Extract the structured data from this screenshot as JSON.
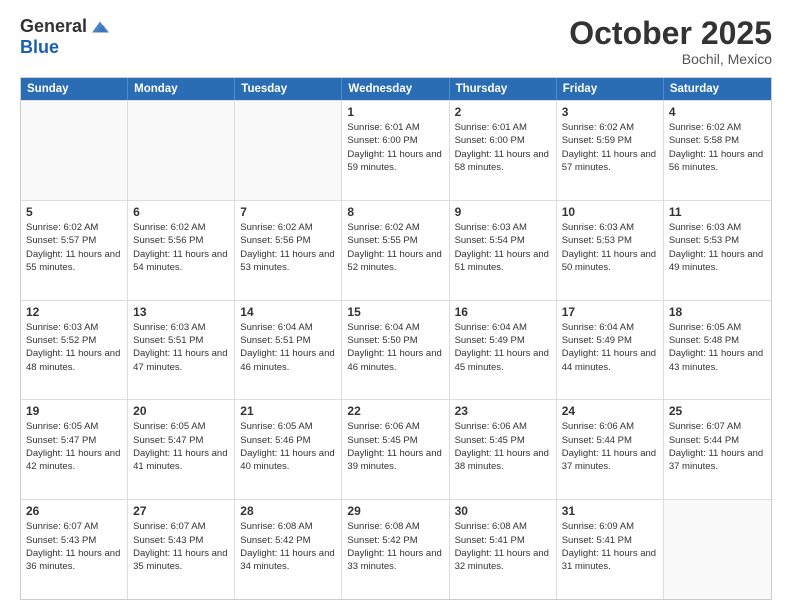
{
  "header": {
    "logo_general": "General",
    "logo_blue": "Blue",
    "month": "October 2025",
    "location": "Bochil, Mexico"
  },
  "weekdays": [
    "Sunday",
    "Monday",
    "Tuesday",
    "Wednesday",
    "Thursday",
    "Friday",
    "Saturday"
  ],
  "weeks": [
    [
      {
        "day": "",
        "text": ""
      },
      {
        "day": "",
        "text": ""
      },
      {
        "day": "",
        "text": ""
      },
      {
        "day": "1",
        "text": "Sunrise: 6:01 AM\nSunset: 6:00 PM\nDaylight: 11 hours and 59 minutes."
      },
      {
        "day": "2",
        "text": "Sunrise: 6:01 AM\nSunset: 6:00 PM\nDaylight: 11 hours and 58 minutes."
      },
      {
        "day": "3",
        "text": "Sunrise: 6:02 AM\nSunset: 5:59 PM\nDaylight: 11 hours and 57 minutes."
      },
      {
        "day": "4",
        "text": "Sunrise: 6:02 AM\nSunset: 5:58 PM\nDaylight: 11 hours and 56 minutes."
      }
    ],
    [
      {
        "day": "5",
        "text": "Sunrise: 6:02 AM\nSunset: 5:57 PM\nDaylight: 11 hours and 55 minutes."
      },
      {
        "day": "6",
        "text": "Sunrise: 6:02 AM\nSunset: 5:56 PM\nDaylight: 11 hours and 54 minutes."
      },
      {
        "day": "7",
        "text": "Sunrise: 6:02 AM\nSunset: 5:56 PM\nDaylight: 11 hours and 53 minutes."
      },
      {
        "day": "8",
        "text": "Sunrise: 6:02 AM\nSunset: 5:55 PM\nDaylight: 11 hours and 52 minutes."
      },
      {
        "day": "9",
        "text": "Sunrise: 6:03 AM\nSunset: 5:54 PM\nDaylight: 11 hours and 51 minutes."
      },
      {
        "day": "10",
        "text": "Sunrise: 6:03 AM\nSunset: 5:53 PM\nDaylight: 11 hours and 50 minutes."
      },
      {
        "day": "11",
        "text": "Sunrise: 6:03 AM\nSunset: 5:53 PM\nDaylight: 11 hours and 49 minutes."
      }
    ],
    [
      {
        "day": "12",
        "text": "Sunrise: 6:03 AM\nSunset: 5:52 PM\nDaylight: 11 hours and 48 minutes."
      },
      {
        "day": "13",
        "text": "Sunrise: 6:03 AM\nSunset: 5:51 PM\nDaylight: 11 hours and 47 minutes."
      },
      {
        "day": "14",
        "text": "Sunrise: 6:04 AM\nSunset: 5:51 PM\nDaylight: 11 hours and 46 minutes."
      },
      {
        "day": "15",
        "text": "Sunrise: 6:04 AM\nSunset: 5:50 PM\nDaylight: 11 hours and 46 minutes."
      },
      {
        "day": "16",
        "text": "Sunrise: 6:04 AM\nSunset: 5:49 PM\nDaylight: 11 hours and 45 minutes."
      },
      {
        "day": "17",
        "text": "Sunrise: 6:04 AM\nSunset: 5:49 PM\nDaylight: 11 hours and 44 minutes."
      },
      {
        "day": "18",
        "text": "Sunrise: 6:05 AM\nSunset: 5:48 PM\nDaylight: 11 hours and 43 minutes."
      }
    ],
    [
      {
        "day": "19",
        "text": "Sunrise: 6:05 AM\nSunset: 5:47 PM\nDaylight: 11 hours and 42 minutes."
      },
      {
        "day": "20",
        "text": "Sunrise: 6:05 AM\nSunset: 5:47 PM\nDaylight: 11 hours and 41 minutes."
      },
      {
        "day": "21",
        "text": "Sunrise: 6:05 AM\nSunset: 5:46 PM\nDaylight: 11 hours and 40 minutes."
      },
      {
        "day": "22",
        "text": "Sunrise: 6:06 AM\nSunset: 5:45 PM\nDaylight: 11 hours and 39 minutes."
      },
      {
        "day": "23",
        "text": "Sunrise: 6:06 AM\nSunset: 5:45 PM\nDaylight: 11 hours and 38 minutes."
      },
      {
        "day": "24",
        "text": "Sunrise: 6:06 AM\nSunset: 5:44 PM\nDaylight: 11 hours and 37 minutes."
      },
      {
        "day": "25",
        "text": "Sunrise: 6:07 AM\nSunset: 5:44 PM\nDaylight: 11 hours and 37 minutes."
      }
    ],
    [
      {
        "day": "26",
        "text": "Sunrise: 6:07 AM\nSunset: 5:43 PM\nDaylight: 11 hours and 36 minutes."
      },
      {
        "day": "27",
        "text": "Sunrise: 6:07 AM\nSunset: 5:43 PM\nDaylight: 11 hours and 35 minutes."
      },
      {
        "day": "28",
        "text": "Sunrise: 6:08 AM\nSunset: 5:42 PM\nDaylight: 11 hours and 34 minutes."
      },
      {
        "day": "29",
        "text": "Sunrise: 6:08 AM\nSunset: 5:42 PM\nDaylight: 11 hours and 33 minutes."
      },
      {
        "day": "30",
        "text": "Sunrise: 6:08 AM\nSunset: 5:41 PM\nDaylight: 11 hours and 32 minutes."
      },
      {
        "day": "31",
        "text": "Sunrise: 6:09 AM\nSunset: 5:41 PM\nDaylight: 11 hours and 31 minutes."
      },
      {
        "day": "",
        "text": ""
      }
    ]
  ]
}
